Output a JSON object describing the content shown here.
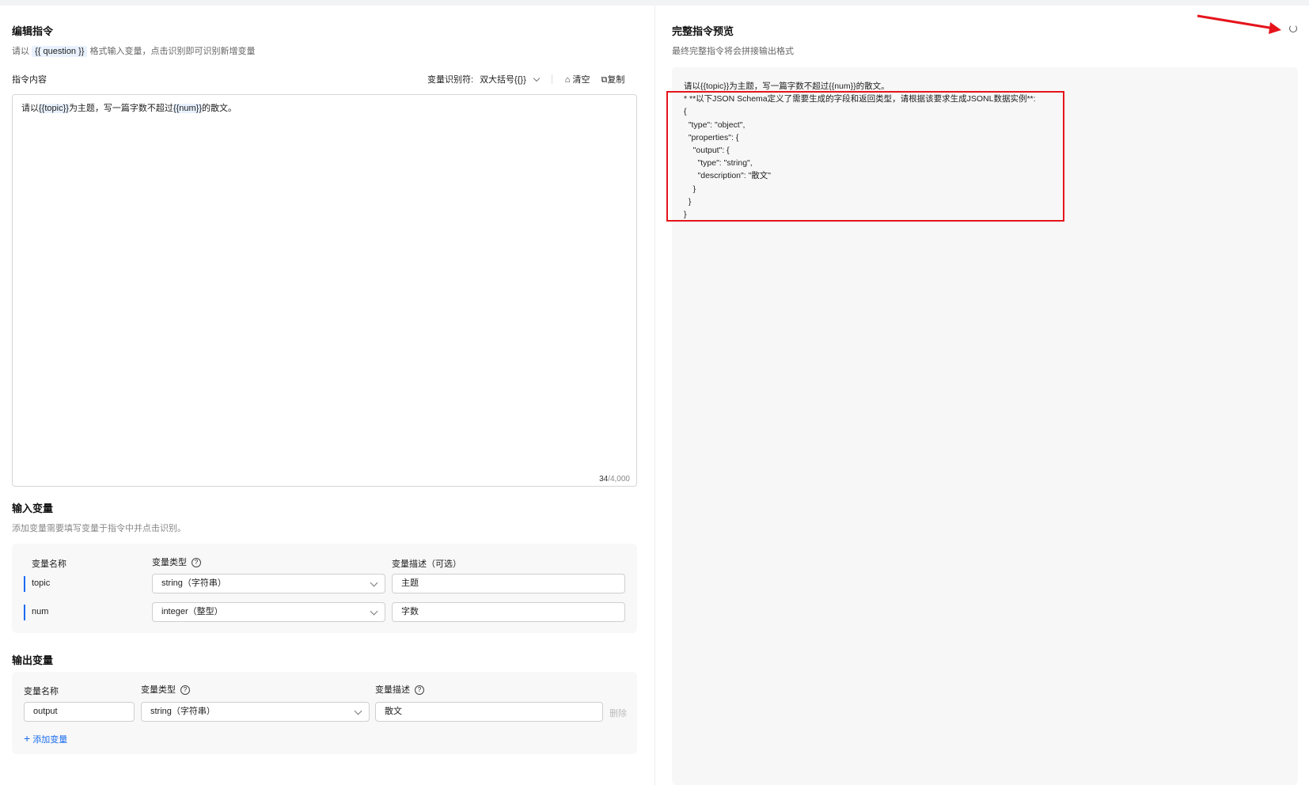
{
  "left": {
    "title": "编辑指令",
    "hint_prefix": "请以",
    "hint_tag": "{{ question }}",
    "hint_suffix": "格式输入变量，点击识别即可识别新增变量",
    "content_label": "指令内容",
    "identifier_label": "变量识别符:",
    "identifier_value": "双大括号{{}}",
    "clear_label": "清空",
    "copy_label": "复制",
    "instruction": {
      "p1": "请以",
      "v1": "{{topic}}",
      "p2": "为主题，写一篇字数不超过",
      "v2": "{{num}}",
      "p3": "的散文。"
    },
    "count": "34",
    "max": "/4,000"
  },
  "input_vars": {
    "title": "输入变量",
    "subtitle": "添加变量需要填写变量于指令中并点击识别。",
    "col_name": "变量名称",
    "col_type": "变量类型",
    "col_desc": "变量描述（可选）",
    "rows": [
      {
        "name": "topic",
        "type": "string（字符串）",
        "desc": "主题"
      },
      {
        "name": "num",
        "type": "integer（整型）",
        "desc": "字数"
      }
    ]
  },
  "output_vars": {
    "title": "输出变量",
    "col_name": "变量名称",
    "col_type": "变量类型",
    "col_desc": "变量描述",
    "rows": [
      {
        "name": "output",
        "type": "string（字符串）",
        "desc": "散文",
        "delete": "删除"
      }
    ],
    "add_label": "添加变量"
  },
  "right": {
    "title": "完整指令预览",
    "subtitle": "最终完整指令将会拼接输出格式",
    "preview": "请以{{topic}}为主题，写一篇字数不超过{{num}}的散文。\n* **以下JSON Schema定义了需要生成的字段和返回类型，请根据该要求生成JSONL数据实例**:\n{\n  \"type\": \"object\",\n  \"properties\": {\n    \"output\": {\n      \"type\": \"string\",\n      \"description\": \"散文\"\n    }\n  }\n}"
  },
  "colors": {
    "accent": "#1a6cf0",
    "annotation": "#e5141c"
  }
}
